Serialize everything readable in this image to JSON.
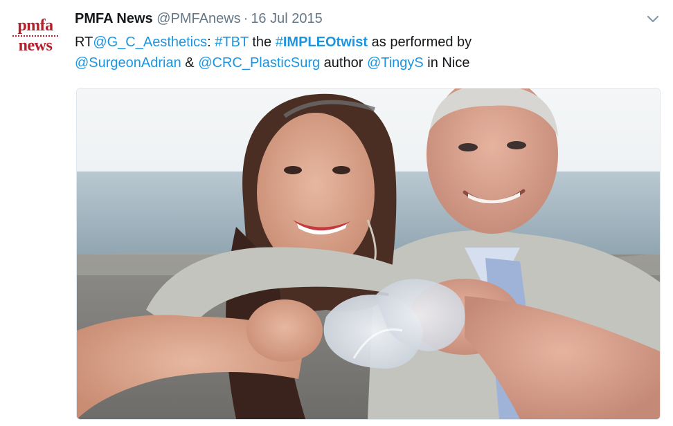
{
  "tweet": {
    "avatar": {
      "line1": "pmfa",
      "line2": "news"
    },
    "display_name": "PMFA News",
    "handle": "@PMFAnews",
    "separator": "·",
    "date": "16 Jul 2015",
    "text_parts": {
      "rt": "RT",
      "mention1": "@G_C_Aesthetics",
      "colon": ": ",
      "hashtag1": "#TBT",
      "the": " the ",
      "hashtag2_prefix": "#",
      "hashtag2_word": "IMPLEOtwist",
      "performed_by": " as performed by",
      "mention2": "@SurgeonAdrian",
      "amp": " & ",
      "mention3": "@CRC_PlasticSurg",
      "author": " author ",
      "mention4": "@TingyS",
      "in_nice": " in Nice"
    },
    "menu_icon": "chevron-down-icon"
  },
  "colors": {
    "link": "#1b95e0",
    "secondary": "#657786",
    "brand": "#b3202b"
  }
}
